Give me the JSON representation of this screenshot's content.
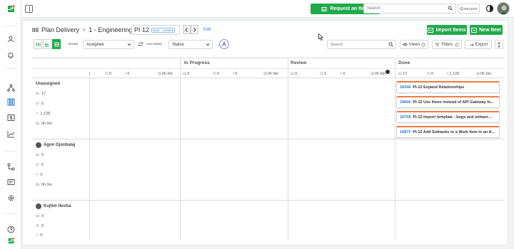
{
  "topbar": {
    "request_label": "Request an Item",
    "search_placeholder": "Search",
    "recent_label": "RECENT"
  },
  "page": {
    "breadcrumb": [
      "Plan Delivery",
      "1 - Engineering"
    ],
    "pi_name": "PI 12",
    "pi_dates": "03/01 - 12/06/24",
    "edit_label": "Edit",
    "import_label": "Import Items",
    "new_label": "New Item"
  },
  "toolbar": {
    "rows_label": "ROWS",
    "rows_value": "Assignee",
    "columns_label": "COLUMNS",
    "columns_value": "Status",
    "search_placeholder": "Search",
    "views_label": "Views",
    "views_count": "0",
    "filters_label": "Filters",
    "filters_count": "0",
    "export_label": "Export"
  },
  "columns": [
    {
      "title": "",
      "items": "0",
      "people": "0",
      "points": "0",
      "time": "0h 0m"
    },
    {
      "title": "In Progress",
      "items": "0",
      "people": "0",
      "points": "0",
      "time": "0h 0m"
    },
    {
      "title": "Review",
      "items": "0",
      "people": "0",
      "points": "0",
      "time": "0h 0m"
    },
    {
      "title": "Done",
      "items": "17",
      "people": "0",
      "points": "1,128",
      "time": "0h 0m"
    }
  ],
  "lanes": [
    {
      "name": "Unassigned",
      "items": "17",
      "people": "0",
      "points": "1,128",
      "time": "0h 0m"
    },
    {
      "name": "Agon Gjonbalaj",
      "items": "0",
      "people": "0",
      "points": "0",
      "time": "0h 0m"
    },
    {
      "name": "Kujtim Hoxha",
      "items": "0",
      "people": "0",
      "points": "0"
    }
  ],
  "cards": [
    {
      "id": "18348",
      "title": "PI-12 Expand Relationships"
    },
    {
      "id": "18666",
      "title": "PI-12 Use Hono instead of API Gateway fo..."
    },
    {
      "id": "18758",
      "title": "PI-12 Import template - bugs and enhanc..."
    },
    {
      "id": "18875",
      "title": "PI-12 Add Subtasks to a Work Item in an A..."
    }
  ],
  "colors": {
    "accent": "#1faa4a",
    "link": "#2a7fd4",
    "card_top": "#f07b3f"
  }
}
